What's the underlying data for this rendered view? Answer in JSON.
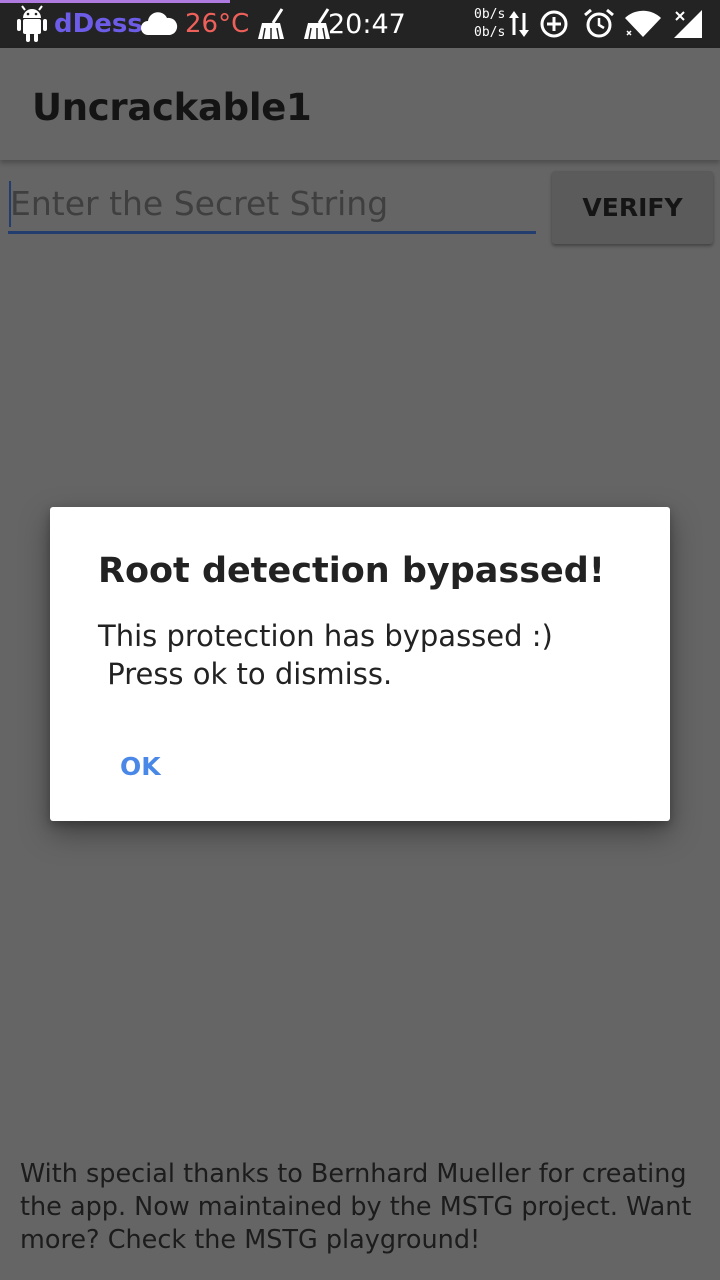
{
  "status_bar": {
    "carrier": "dDess",
    "temperature": "26°C",
    "time": "20:47",
    "upload_speed": "0b/s",
    "download_speed": "0b/s",
    "carrier_color": "#6d5ce8",
    "temperature_color": "#f0605a",
    "progress_fraction": 0.32
  },
  "app_bar": {
    "title": "Uncrackable1"
  },
  "form": {
    "input_value": "",
    "input_placeholder": "Enter the Secret String",
    "verify_label": "VERIFY"
  },
  "dialog": {
    "title": "Root detection bypassed!",
    "message": "This protection has bypassed :)\n Press ok to dismiss.",
    "ok_label": "OK",
    "ok_color": "#4a88e8"
  },
  "footer": {
    "text": "With special thanks to Bernhard Mueller for creating the app. Now maintained by the MSTG project. Want more? Check the MSTG playground!"
  },
  "icons": [
    "android-icon",
    "cloud-icon",
    "cleaner-broom-icon",
    "cleaner-broom-icon",
    "data-transfer-icon",
    "data-saver-icon",
    "alarm-icon",
    "wifi-icon",
    "signal-icon"
  ]
}
